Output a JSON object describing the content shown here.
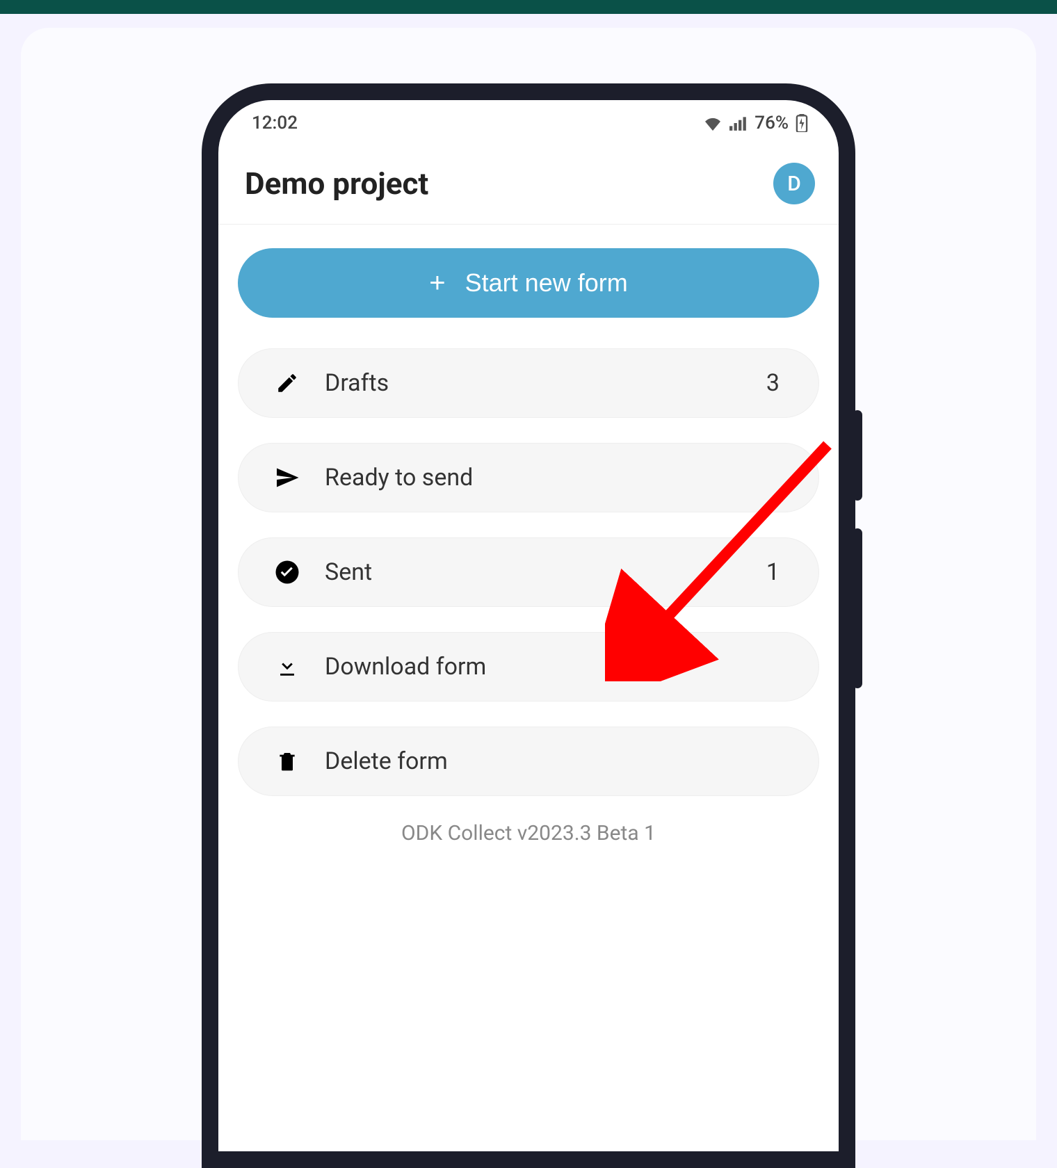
{
  "status": {
    "time": "12:02",
    "battery": "76%"
  },
  "header": {
    "title": "Demo project",
    "avatar_initial": "D"
  },
  "buttons": {
    "start_label": "Start new form"
  },
  "items": {
    "drafts": {
      "label": "Drafts",
      "count": "3"
    },
    "ready": {
      "label": "Ready to send",
      "count": ""
    },
    "sent": {
      "label": "Sent",
      "count": "1"
    },
    "download": {
      "label": "Download form",
      "count": ""
    },
    "delete": {
      "label": "Delete form",
      "count": ""
    }
  },
  "footer": {
    "version": "ODK Collect v2023.3 Beta 1"
  },
  "colors": {
    "accent": "#4fa8d0",
    "arrow": "#ff0000"
  }
}
